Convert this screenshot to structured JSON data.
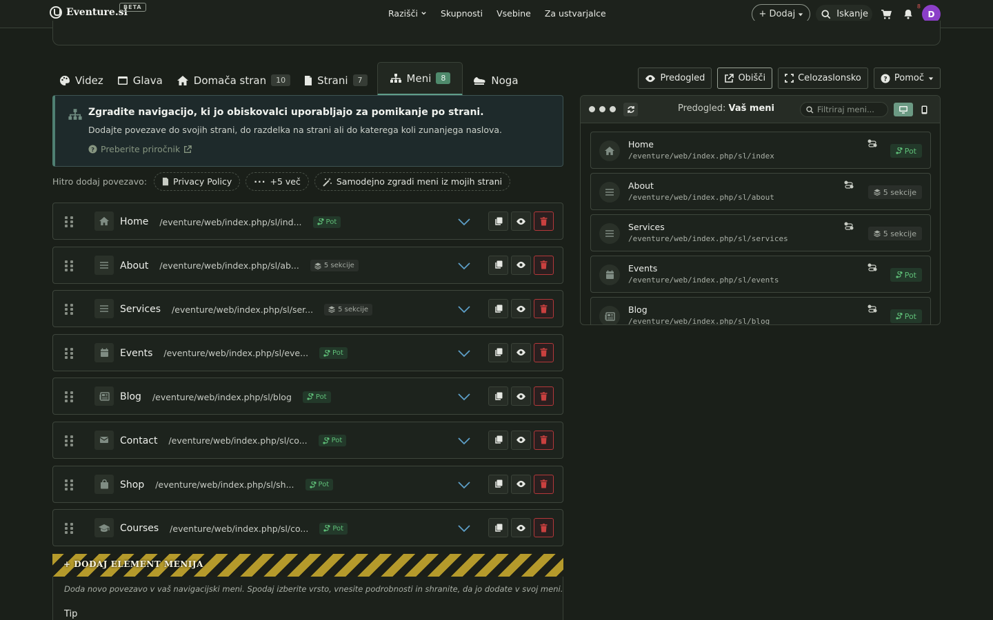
{
  "brand": {
    "name": "Eventure.si",
    "beta": "BETA"
  },
  "nav": {
    "items": [
      "Razišči",
      "Skupnosti",
      "Vsebine",
      "Za ustvarjalce"
    ]
  },
  "top_right": {
    "add_label": "+ Dodaj",
    "search_label": "Iskanje",
    "notif_count": "8",
    "avatar_initial": "D"
  },
  "tabs": [
    {
      "label": "Videz",
      "icon": "palette-icon"
    },
    {
      "label": "Glava",
      "icon": "window-icon"
    },
    {
      "label": "Domača stran",
      "count": "10",
      "icon": "home-icon"
    },
    {
      "label": "Strani",
      "count": "7",
      "icon": "file-icon"
    },
    {
      "label": "Meni",
      "count": "8",
      "icon": "sitemap-icon",
      "active": true
    },
    {
      "label": "Noga",
      "icon": "shoe-icon"
    }
  ],
  "toolbar": {
    "preview": "Predogled",
    "visit": "Obišči",
    "fullscreen": "Celozaslonsko",
    "help": "Pomoč"
  },
  "info": {
    "title": "Zgradite navigacijo, ki jo obiskovalci uporabljajo za pomikanje po strani.",
    "text": "Dodajte povezave do svojih strani, do razdelka na strani ali do katerega koli zunanjega naslova.",
    "link": "Preberite priročnik"
  },
  "quick_add": {
    "label": "Hitro dodaj povezavo:",
    "chips": [
      "Privacy Policy",
      "+5 več",
      "Samodejno zgradi meni iz mojih strani"
    ]
  },
  "menu_items": [
    {
      "name": "Home",
      "path": "/eventure/web/index.php/sl/ind...",
      "badge": "Pot",
      "type": "pot",
      "icon": "home-icon"
    },
    {
      "name": "About",
      "path": "/eventure/web/index.php/sl/ab...",
      "badge": "5 sekcije",
      "type": "sek",
      "icon": "list-icon"
    },
    {
      "name": "Services",
      "path": "/eventure/web/index.php/sl/ser...",
      "badge": "5 sekcije",
      "type": "sek",
      "icon": "list-icon"
    },
    {
      "name": "Events",
      "path": "/eventure/web/index.php/sl/eve...",
      "badge": "Pot",
      "type": "pot",
      "icon": "calendar-icon"
    },
    {
      "name": "Blog",
      "path": "/eventure/web/index.php/sl/blog",
      "badge": "Pot",
      "type": "pot",
      "icon": "newspaper-icon"
    },
    {
      "name": "Contact",
      "path": "/eventure/web/index.php/sl/co...",
      "badge": "Pot",
      "type": "pot",
      "icon": "envelope-icon"
    },
    {
      "name": "Shop",
      "path": "/eventure/web/index.php/sl/sh...",
      "badge": "Pot",
      "type": "pot",
      "icon": "bag-icon"
    },
    {
      "name": "Courses",
      "path": "/eventure/web/index.php/sl/co...",
      "badge": "Pot",
      "type": "pot",
      "icon": "graduation-icon"
    }
  ],
  "add_element": {
    "title": "+ DODAJ ELEMENT MENIJA",
    "description": "Doda novo povezavo v vaš navigacijski meni. Spodaj izberite vrsto, vnesite podrobnosti in shranite, da jo dodate v svoj meni.",
    "tip_label": "Tip"
  },
  "preview": {
    "title_prefix": "Predogled:",
    "title_bold": "Vaš meni",
    "filter_placeholder": "Filtriraj meni...",
    "items": [
      {
        "name": "Home",
        "path": "/eventure/web/index.php/sl/index",
        "badge": "Pot",
        "type": "pot",
        "icon": "home-icon"
      },
      {
        "name": "About",
        "path": "/eventure/web/index.php/sl/about",
        "badge": "5 sekcije",
        "type": "sek",
        "icon": "list-icon"
      },
      {
        "name": "Services",
        "path": "/eventure/web/index.php/sl/services",
        "badge": "5 sekcije",
        "type": "sek",
        "icon": "list-icon"
      },
      {
        "name": "Events",
        "path": "/eventure/web/index.php/sl/events",
        "badge": "Pot",
        "type": "pot",
        "icon": "calendar-icon"
      },
      {
        "name": "Blog",
        "path": "/eventure/web/index.php/sl/blog",
        "badge": "Pot",
        "type": "pot",
        "icon": "newspaper-icon"
      }
    ]
  },
  "colors": {
    "accent": "#5f9e8a",
    "pot": "#5fbf78",
    "danger": "#b5383a",
    "avatar": "#8b3fc8"
  }
}
